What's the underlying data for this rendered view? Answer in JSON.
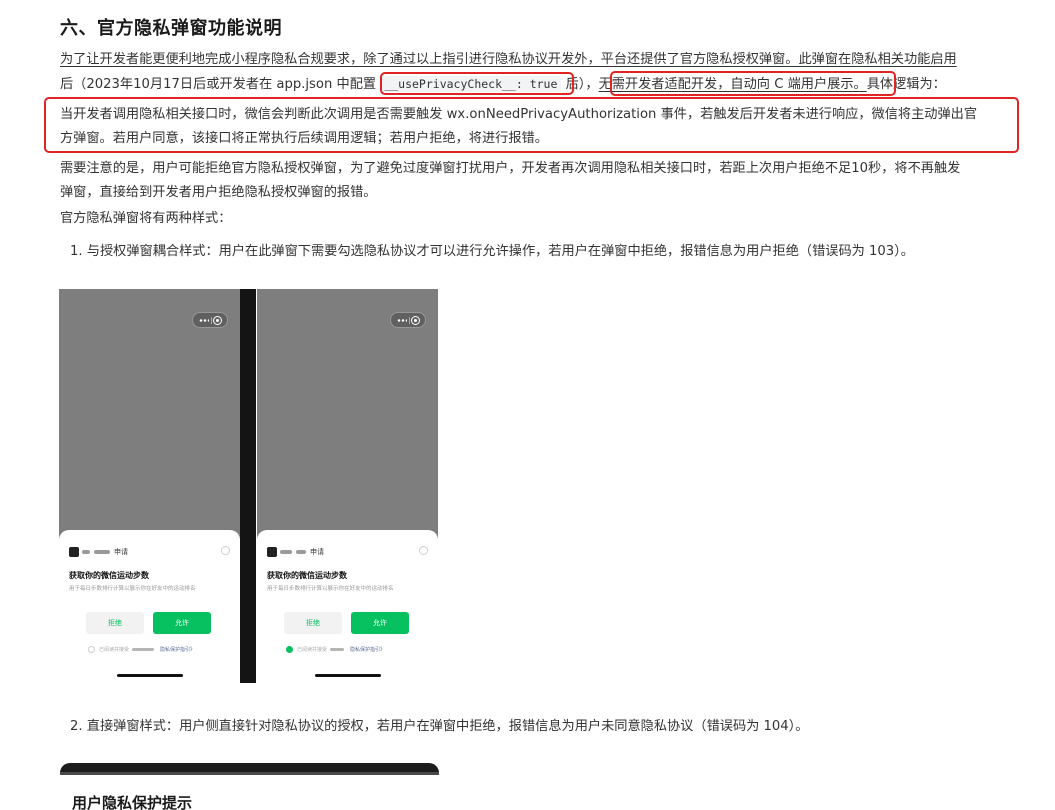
{
  "section": {
    "title": "六、官方隐私弹窗功能说明"
  },
  "intro": {
    "line1": "为了让开发者能更便利地完成小程序隐私合规要求，除了通过以上指引进行隐私协议开发外，平台还提供了官方隐私授权弹窗。此弹窗在隐私相关功能启用",
    "line2_a": "后（2023年10月17日后或开发者在 app.json 中配置 ",
    "code": "__usePrivacyCheck__: true",
    "line2_b": " 后），",
    "line2_highlight": "无需开发者适配开发，自动向 C 端用户展示。",
    "line2_c": "具体逻辑为："
  },
  "logic": {
    "line1": "当开发者调用隐私相关接口时，微信会判断此次调用是否需要触发 wx.onNeedPrivacyAuthorization 事件，若触发后开发者未进行响应，微信将主动弹出官",
    "line2": "方弹窗。若用户同意，该接口将正常执行后续调用逻辑；若用户拒绝，将进行报错。"
  },
  "note": {
    "line1": "需要注意的是，用户可能拒绝官方隐私授权弹窗，为了避免过度弹窗打扰用户，开发者再次调用隐私相关接口时，若距上次用户拒绝不足10秒，将不再触发",
    "line2": "弹窗，直接给到开发者用户拒绝隐私授权弹窗的报错。"
  },
  "styles_intro": "官方隐私弹窗将有两种样式：",
  "item1": "1. 与授权弹窗耦合样式：用户在此弹窗下需要勾选隐私协议才可以进行允许操作，若用户在弹窗中拒绝，报错信息为用户拒绝（错误码为 103）。",
  "popup": {
    "apply": "申请",
    "title": "获取你的微信运动步数",
    "subtitle": "用于每日步数排行计算以展示你在好友中的运动排名",
    "reject": "拒绝",
    "allow": "允许",
    "agree_text": "已阅读并接受",
    "guide_link": "隐私保护指引》"
  },
  "item2": "2. 直接弹窗样式：用户侧直接针对隐私协议的授权，若用户在弹窗中拒绝，报错信息为用户未同意隐私协议（错误码为 104）。",
  "preview_title": "用户隐私保护提示",
  "colors": {
    "highlight_border": "#e02424",
    "wechat_green": "#07c160",
    "link": "#576b95"
  }
}
